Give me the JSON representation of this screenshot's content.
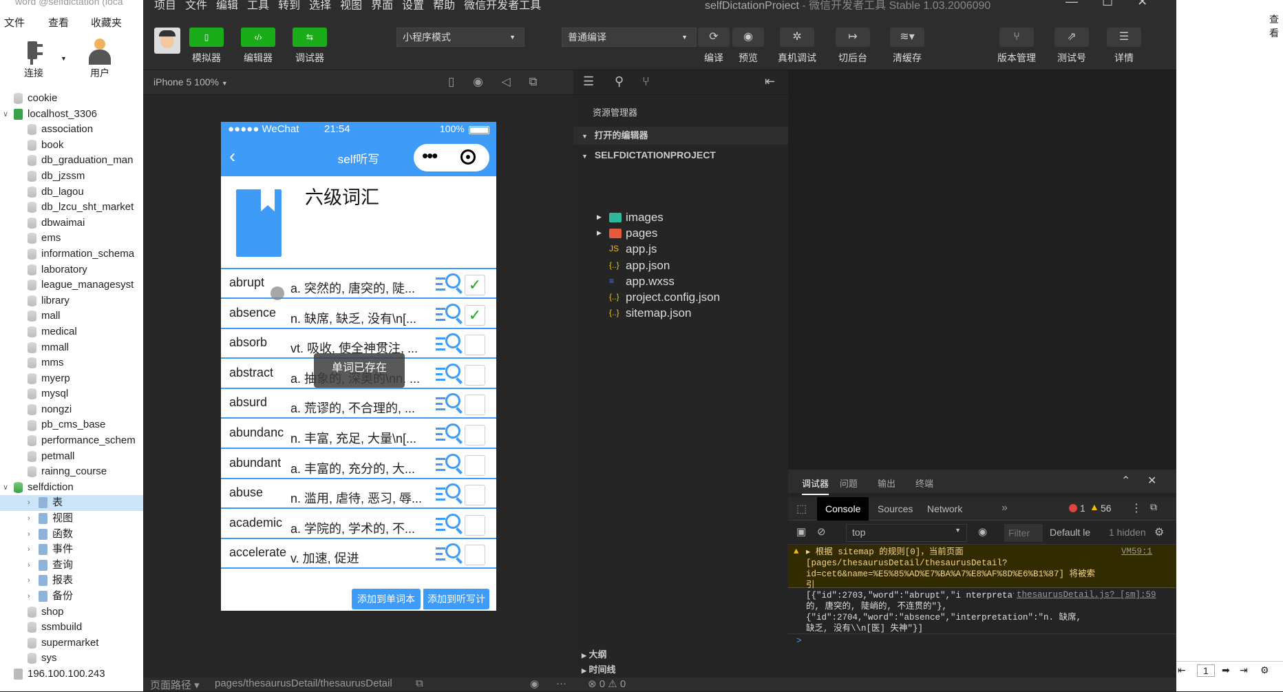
{
  "left_panel": {
    "title_fragment": "word @selfdictation (loca",
    "menu": [
      "文件",
      "查看",
      "收藏夹"
    ],
    "toolbar": {
      "connect": "连接",
      "user": "用户"
    },
    "tree": [
      {
        "label": "cookie",
        "level": 1
      },
      {
        "label": "localhost_3306",
        "level": 0,
        "expanded": true
      },
      {
        "label": "association",
        "level": 2
      },
      {
        "label": "book",
        "level": 2
      },
      {
        "label": "db_graduation_man",
        "level": 2
      },
      {
        "label": "db_jzssm",
        "level": 2
      },
      {
        "label": "db_lagou",
        "level": 2
      },
      {
        "label": "db_lzcu_sht_market",
        "level": 2
      },
      {
        "label": "dbwaimai",
        "level": 2
      },
      {
        "label": "ems",
        "level": 2
      },
      {
        "label": "information_schema",
        "level": 2
      },
      {
        "label": "laboratory",
        "level": 2
      },
      {
        "label": "league_managesyst",
        "level": 2
      },
      {
        "label": "library",
        "level": 2
      },
      {
        "label": "mall",
        "level": 2
      },
      {
        "label": "medical",
        "level": 2
      },
      {
        "label": "mmall",
        "level": 2
      },
      {
        "label": "mms",
        "level": 2
      },
      {
        "label": "myerp",
        "level": 2
      },
      {
        "label": "mysql",
        "level": 2
      },
      {
        "label": "nongzi",
        "level": 2
      },
      {
        "label": "pb_cms_base",
        "level": 2
      },
      {
        "label": "performance_schem",
        "level": 2
      },
      {
        "label": "petmall",
        "level": 2
      },
      {
        "label": "rainng_course",
        "level": 2
      },
      {
        "label": "selfdiction",
        "level": 1,
        "expanded": true
      },
      {
        "label": "表",
        "level": 3,
        "selected": true
      },
      {
        "label": "视图",
        "level": 3
      },
      {
        "label": "函数",
        "level": 3
      },
      {
        "label": "事件",
        "level": 3
      },
      {
        "label": "查询",
        "level": 3
      },
      {
        "label": "报表",
        "level": 3
      },
      {
        "label": "备份",
        "level": 3
      },
      {
        "label": "shop",
        "level": 2
      },
      {
        "label": "ssmbuild",
        "level": 2
      },
      {
        "label": "supermarket",
        "level": 2
      },
      {
        "label": "sys",
        "level": 2
      },
      {
        "label": "196.100.100.243",
        "level": 0
      }
    ]
  },
  "menubar": {
    "items": [
      "项目",
      "文件",
      "编辑",
      "工具",
      "转到",
      "选择",
      "视图",
      "界面",
      "设置",
      "帮助",
      "微信开发者工具"
    ],
    "title": "selfDictationProject",
    "subtitle": "- 微信开发者工具 Stable 1.03.2006090"
  },
  "toolbar": {
    "simulator": "模拟器",
    "editor": "编辑器",
    "debugger": "调试器",
    "mode_select": "小程序模式",
    "compile_select": "普通编译",
    "compile": "编译",
    "preview": "预览",
    "real_debug": "真机调试",
    "background": "切后台",
    "clear_cache": "清缓存",
    "version_mgmt": "版本管理",
    "test_account": "测试号",
    "details": "详情"
  },
  "simulator": {
    "device": "iPhone 5 100%",
    "status": {
      "carrier": "●●●●● WeChat",
      "time": "21:54",
      "battery": "100%"
    },
    "nav_title": "self听写",
    "header_title": "六级词汇",
    "words": [
      {
        "word": "abrupt",
        "meaning": "a. 突然的, 唐突的, 陡...",
        "checked": true
      },
      {
        "word": "absence",
        "meaning": "n. 缺席, 缺乏, 没有\\n[...",
        "checked": true
      },
      {
        "word": "absorb",
        "meaning": "vt. 吸收, 使全神贯注, ...",
        "checked": false
      },
      {
        "word": "abstract",
        "meaning": "a. 抽象的, 深奥的\\nn. ...",
        "checked": false
      },
      {
        "word": "absurd",
        "meaning": "a. 荒谬的, 不合理的, ...",
        "checked": false
      },
      {
        "word": "abundanc",
        "meaning": "n. 丰富, 充足, 大量\\n[...",
        "checked": false
      },
      {
        "word": "abundant",
        "meaning": "a. 丰富的, 充分的, 大...",
        "checked": false
      },
      {
        "word": "abuse",
        "meaning": "n. 滥用, 虐待, 恶习, 辱...",
        "checked": false
      },
      {
        "word": "academic",
        "meaning": "a. 学院的, 学术的, 不...",
        "checked": false
      },
      {
        "word": "accelerate",
        "meaning": "v. 加速, 促进",
        "checked": false
      }
    ],
    "toast": "单词已存在",
    "btn_add_wordbook": "添加到单词本",
    "btn_add_plan": "添加到听写计划"
  },
  "explorer": {
    "title": "资源管理器",
    "open_editors": "打开的编辑器",
    "project": "SELFDICTATIONPROJECT",
    "files": [
      {
        "name": "images",
        "type": "folder"
      },
      {
        "name": "pages",
        "type": "folder"
      },
      {
        "name": "app.js",
        "type": "js"
      },
      {
        "name": "app.json",
        "type": "json"
      },
      {
        "name": "app.wxss",
        "type": "css"
      },
      {
        "name": "project.config.json",
        "type": "json"
      },
      {
        "name": "sitemap.json",
        "type": "json"
      }
    ],
    "outline": "大纲",
    "timeline": "时间线",
    "problems": "⊗ 0 ⚠ 0"
  },
  "console": {
    "tabs": [
      "调试器",
      "问题",
      "输出",
      "终端"
    ],
    "subtabs": [
      "Console",
      "Sources",
      "Network"
    ],
    "errors": "1",
    "warnings": "56",
    "context": "top",
    "filter_placeholder": "Filter",
    "level": "Default le",
    "hidden": "1 hidden",
    "warning_msg": "▸ 根据 sitemap 的规则[0]，当前页面 [pages/thesaurusDetail/thesaurusDetail?id=cet6&name=%E5%85%AD%E7%BA%A7%E8%AF%8D%E6%B1%87] 将被索引",
    "warning_src": "VM59:1",
    "log_msg": "[{\"id\":2703,\"word\":\"abrupt\",\"i nterpretation\":\"a. 突然的, 唐突的, 陡峭的, 不连贯的\"},{\"id\":2704,\"word\":\"absence\",\"interpretation\":\"n. 缺席, 缺乏, 没有\\\\n[医] 失神\"}]",
    "log_src": "thesaurusDetail.js? [sm]:59",
    "prompt": ">"
  },
  "statusbar": {
    "path_label": "页面路径 ▾",
    "path": "pages/thesaurusDetail/thesaurusDetail"
  },
  "right_strip": {
    "page": "1",
    "top_label": "查看"
  }
}
